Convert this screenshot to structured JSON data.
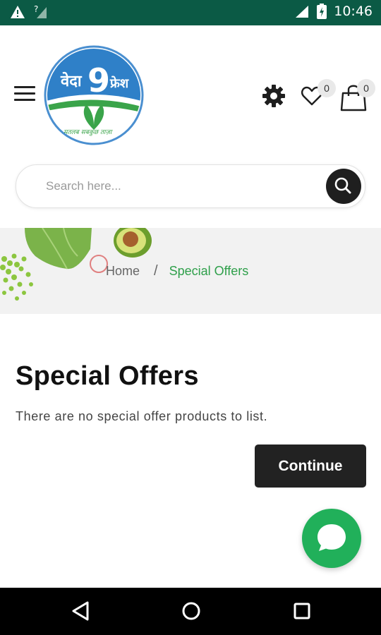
{
  "status_bar": {
    "time": "10:46",
    "icons": [
      "warning-icon",
      "no-signal-icon",
      "signal-icon",
      "battery-charging-icon"
    ]
  },
  "header": {
    "logo": {
      "text_left": "वेदा",
      "text_number": "9",
      "text_right": "फ्रेश",
      "tagline": "मतलब सबकुछ ताज़ा",
      "colors": {
        "sky": "#2f80c8",
        "ring": "#4a8fd0",
        "leaf": "#3aa44a"
      }
    },
    "menu_icon": "hamburger-menu-icon",
    "settings_icon": "gear-icon",
    "wishlist": {
      "icon": "heart-icon",
      "count": "0"
    },
    "cart": {
      "icon": "shopping-bag-icon",
      "count": "0"
    }
  },
  "search": {
    "placeholder": "Search here...",
    "value": "",
    "button_icon": "search-icon"
  },
  "breadcrumb": {
    "home": "Home",
    "separator": "/",
    "current": "Special Offers"
  },
  "page": {
    "title": "Special Offers",
    "empty_message": "There are no special offer products to list.",
    "continue_label": "Continue"
  },
  "chat": {
    "icon": "chat-bubble-icon",
    "color": "#21b05a"
  },
  "nav_bar": {
    "items": [
      "back-icon",
      "home-icon",
      "recents-icon"
    ]
  },
  "colors": {
    "status_bar": "#0b5a45",
    "accent_green": "#2e9f4a",
    "button_dark": "#222222"
  }
}
